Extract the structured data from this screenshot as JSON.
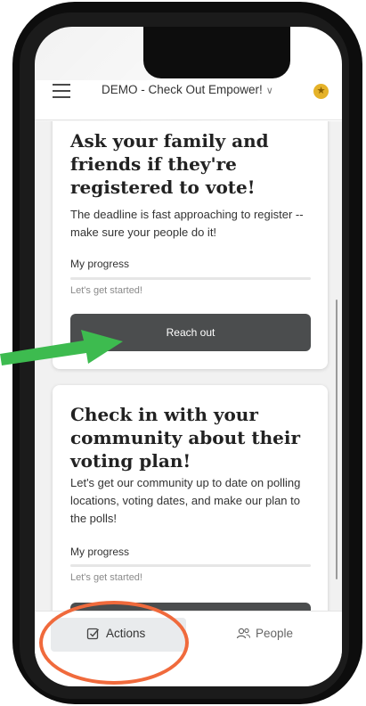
{
  "header": {
    "title": "DEMO - Check Out Empower!"
  },
  "cards": [
    {
      "title": "Ask your family and friends if they're registered to vote!",
      "description": "The deadline is fast approaching to register -- make sure your people do it!",
      "progress_label": "My progress",
      "progress_value": 0,
      "progress_text": "Let's get started!",
      "button_label": "Reach out"
    },
    {
      "title": "Check in with your community about their voting plan!",
      "description": "Let's get our community up to date on polling locations, voting dates, and make our plan to the polls!",
      "progress_label": "My progress",
      "progress_value": 0,
      "progress_text": "Let's get started!"
    }
  ],
  "tabbar": {
    "actions_label": "Actions",
    "people_label": "People"
  },
  "colors": {
    "button": "#4b4d4e",
    "annotation_arrow": "#3dbb4f",
    "annotation_circle": "#f06a3c",
    "star": "#e5b229"
  },
  "icons": [
    "menu-icon",
    "chevron-down-icon",
    "star-icon",
    "checkbox-icon",
    "people-icon"
  ]
}
